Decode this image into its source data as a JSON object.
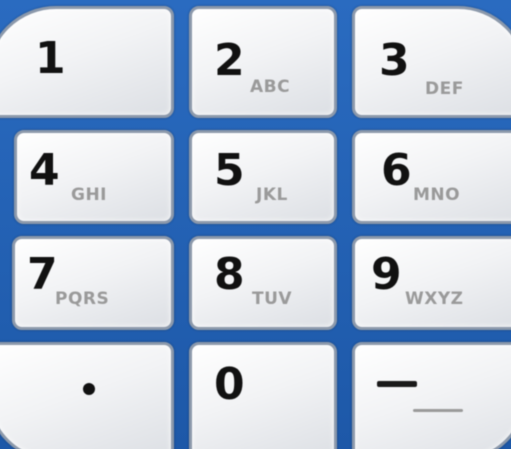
{
  "keypad": {
    "keys": [
      {
        "digit": "1",
        "letters": ""
      },
      {
        "digit": "2",
        "letters": "ABC"
      },
      {
        "digit": "3",
        "letters": "DEF"
      },
      {
        "digit": "4",
        "letters": "GHI"
      },
      {
        "digit": "5",
        "letters": "JKL"
      },
      {
        "digit": "6",
        "letters": "MNO"
      },
      {
        "digit": "7",
        "letters": "PQRS"
      },
      {
        "digit": "8",
        "letters": "TUV"
      },
      {
        "digit": "9",
        "letters": "WXYZ"
      },
      {
        "digit": "",
        "letters": "",
        "icon": "dot-icon"
      },
      {
        "digit": "0",
        "letters": ""
      },
      {
        "digit": "",
        "letters": "",
        "icon": "space-underscore-icon"
      }
    ]
  },
  "colors": {
    "background": "#1f5fb3",
    "key_face": "#f2f3f5",
    "key_border": "#8c99ab",
    "digit": "#111111",
    "letters": "#9a9a9a"
  }
}
